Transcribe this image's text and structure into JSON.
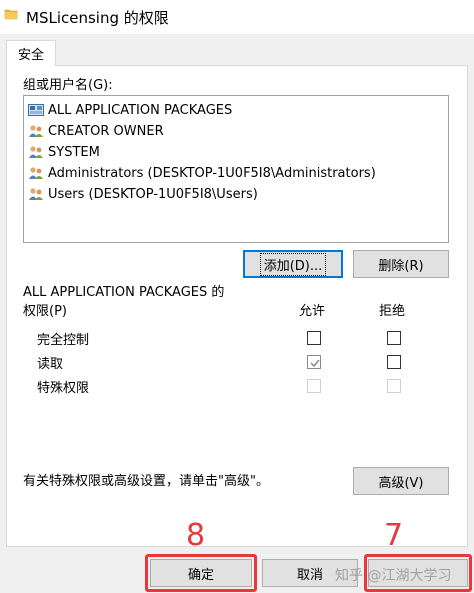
{
  "window": {
    "title": "MSLicensing 的权限",
    "icon": "folder-icon"
  },
  "tabs": [
    {
      "label": "安全",
      "selected": true
    }
  ],
  "groups": {
    "label": "组或用户名(G):",
    "items": [
      {
        "name": "ALL APPLICATION PACKAGES",
        "icon": "app-packages-icon",
        "selected": true
      },
      {
        "name": "CREATOR OWNER",
        "icon": "users-icon",
        "selected": false
      },
      {
        "name": "SYSTEM",
        "icon": "users-icon",
        "selected": false
      },
      {
        "name": "Administrators (DESKTOP-1U0F5I8\\Administrators)",
        "icon": "users-icon",
        "selected": false
      },
      {
        "name": "Users (DESKTOP-1U0F5I8\\Users)",
        "icon": "users-icon",
        "selected": false
      }
    ]
  },
  "buttons": {
    "add": "添加(D)...",
    "remove": "删除(R)",
    "advanced": "高级(V)",
    "ok": "确定",
    "cancel": "取消"
  },
  "permissions": {
    "heading_line1": "ALL APPLICATION PACKAGES 的",
    "heading_line2": "权限(P)",
    "allow_label": "允许",
    "deny_label": "拒绝",
    "rows": [
      {
        "name": "完全控制",
        "allow": false,
        "deny": false,
        "disabled": false
      },
      {
        "name": "读取",
        "allow": true,
        "deny": false,
        "disabled": false,
        "allow_greyed": true
      },
      {
        "name": "特殊权限",
        "allow": false,
        "deny": false,
        "disabled": true
      }
    ]
  },
  "advanced_hint": "有关特殊权限或高级设置，请单击\"高级\"。",
  "annotations": [
    {
      "number": "8",
      "color": "#e8383d"
    },
    {
      "number": "7",
      "color": "#e8383d"
    }
  ],
  "watermark": "知乎 @江湖大学习"
}
